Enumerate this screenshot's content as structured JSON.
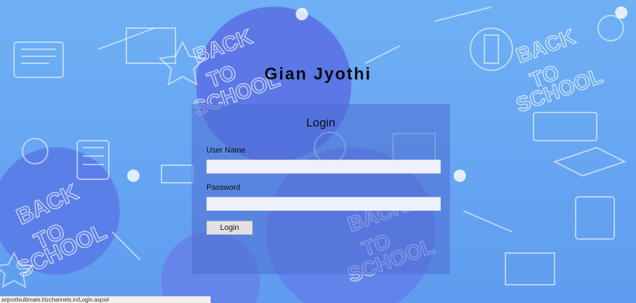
{
  "app": {
    "title": "Gian Jyothi"
  },
  "login": {
    "heading": "Login",
    "username_label": "User Name",
    "username_value": "",
    "password_label": "Password",
    "password_value": "",
    "submit_label": "Login"
  },
  "background_decor_text": [
    "BACK TO SCHOOL"
  ],
  "status_bar": {
    "url": "anjvothiultimate.litzchannels.in/Login.aspx#"
  },
  "colors": {
    "background": "#6aa6ee",
    "panel": "#4e6ed2",
    "button": "#e2e2e4"
  }
}
